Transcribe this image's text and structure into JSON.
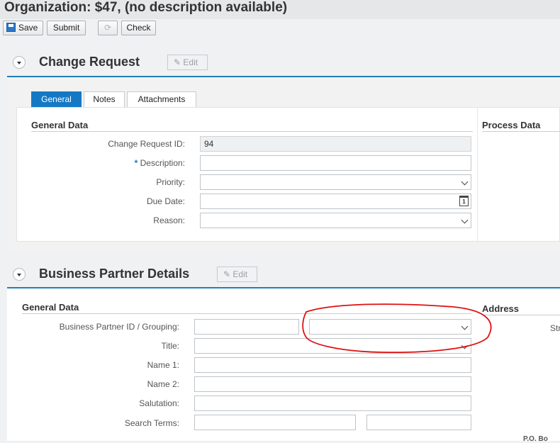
{
  "page": {
    "title": "Organization: $47, (no description available)"
  },
  "toolbar": {
    "save": "Save",
    "submit": "Submit",
    "refresh_icon": "refresh-icon",
    "check": "Check"
  },
  "change_request": {
    "title": "Change Request",
    "edit": "Edit",
    "tabs": [
      "General",
      "Notes",
      "Attachments"
    ],
    "general_data_title": "General Data",
    "process_data_title": "Process Data",
    "fields": {
      "id_label": "Change Request ID:",
      "id_value": "94",
      "required_marker": "*",
      "description_label": "Description:",
      "priority_label": "Priority:",
      "due_date_label": "Due Date:",
      "calendar_glyph": "1",
      "reason_label": "Reason:"
    }
  },
  "business_partner": {
    "title": "Business Partner Details",
    "edit": "Edit",
    "general_data_title": "General Data",
    "address_title": "Address",
    "address_street_label": "Str",
    "address_bottom_fragment": "P.O. Bo",
    "fields": {
      "bp_id_label": "Business Partner ID / Grouping:",
      "title_label": "Title:",
      "name1_label": "Name 1:",
      "name2_label": "Name 2:",
      "salutation_label": "Salutation:",
      "search_terms_label": "Search Terms:"
    }
  },
  "annotation": {
    "color": "#e01010",
    "shape": "hand-drawn ellipse around grouping dropdown"
  }
}
